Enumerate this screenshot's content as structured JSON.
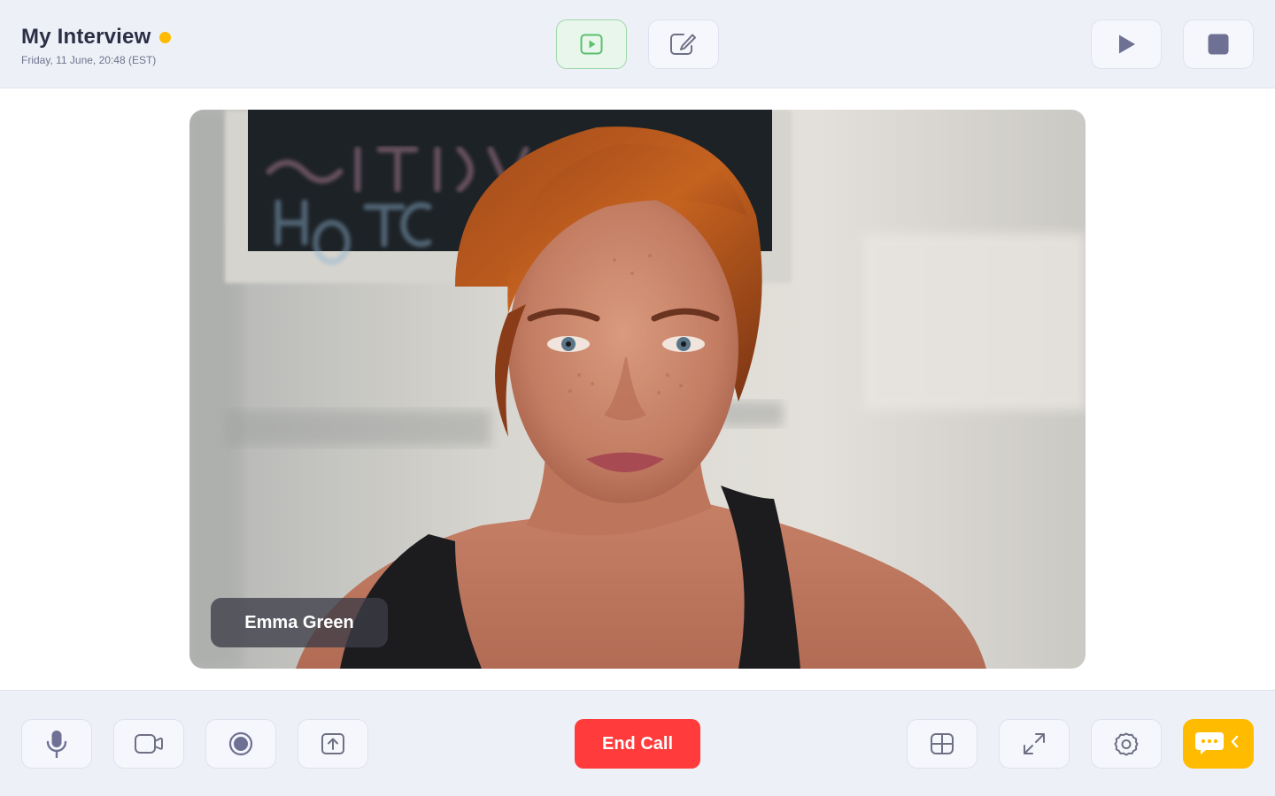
{
  "header": {
    "title": "My Interview",
    "subtitle": "Friday, 11 June, 20:48 (EST)",
    "status_color": "#ffbb00",
    "tools": [
      {
        "icon": "video-play-icon",
        "active": true
      },
      {
        "icon": "edit-note-icon",
        "active": false
      }
    ],
    "media_controls": [
      {
        "icon": "play-icon"
      },
      {
        "icon": "stop-icon"
      }
    ]
  },
  "participant": {
    "name": "Emma Green"
  },
  "footer": {
    "end_call_label": "End Call",
    "left_controls": [
      "microphone-icon",
      "camera-icon",
      "record-icon",
      "share-screen-icon"
    ],
    "right_controls": [
      "layout-grid-icon",
      "fullscreen-icon",
      "settings-icon",
      "chat-icon"
    ]
  },
  "colors": {
    "accent_yellow": "#ffbb00",
    "end_call_red": "#ff3b3b",
    "active_green": "#5cc06e",
    "icon_gray": "#6e7084"
  }
}
